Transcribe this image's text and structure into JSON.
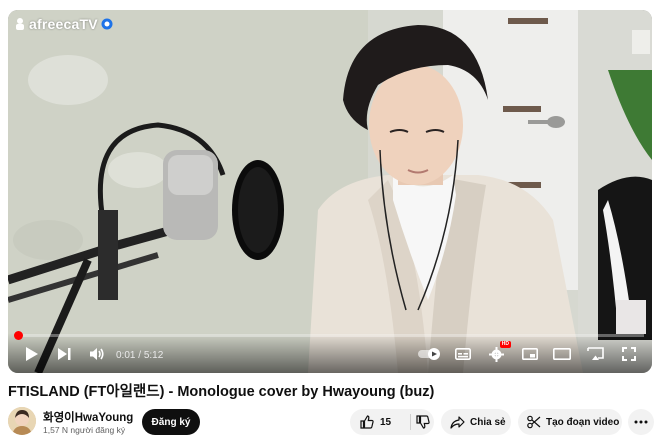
{
  "player": {
    "watermark": "afreecaTV",
    "current_time": "0:01",
    "duration": "5:12",
    "progress_fraction": 0.003,
    "controls": {
      "play_icon": "play-icon",
      "next_icon": "next-icon",
      "volume_icon": "volume-icon",
      "autoplay_icon": "autoplay-toggle-icon",
      "subtitles_icon": "subtitles-icon",
      "settings_icon": "gear-icon",
      "settings_badge": "HD",
      "miniplayer_icon": "miniplayer-icon",
      "theater_icon": "theater-mode-icon",
      "cast_icon": "cast-icon",
      "fullscreen_icon": "fullscreen-icon"
    }
  },
  "video": {
    "title": "FTISLAND (FT아일랜드) - Monologue cover by Hwayoung (buz)"
  },
  "channel": {
    "name": "화영이HwaYoung",
    "subscribers": "1,57 N người đăng ký",
    "subscribe_label": "Đăng ký"
  },
  "actions": {
    "like_count": "15",
    "share_label": "Chia sẻ",
    "clip_label": "Tạo đoạn video",
    "more_icon": "more-horizontal-icon"
  },
  "colors": {
    "progress": "#ff0000",
    "subscribe_bg": "#0f0f0f",
    "pill_bg": "#f2f2f2"
  }
}
